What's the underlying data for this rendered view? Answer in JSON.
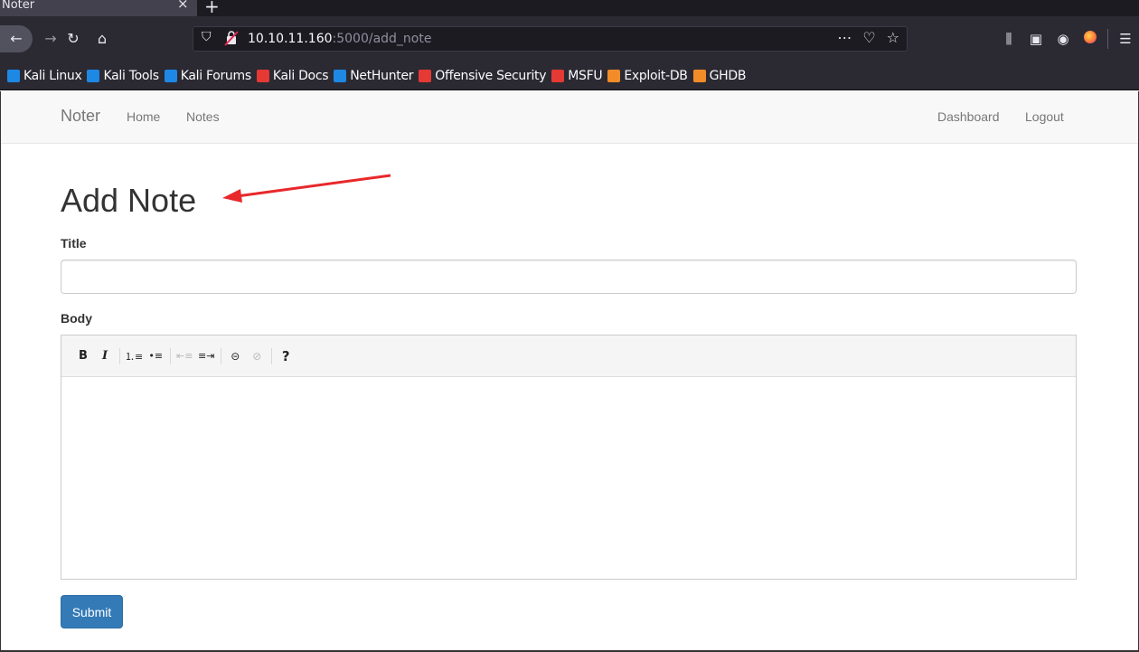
{
  "browser": {
    "tab_title": "Noter",
    "tab_close": "×",
    "new_tab": "+",
    "url_host": "10.10.11.160",
    "url_rest": ":5000/add_note",
    "bookmarks": [
      {
        "label": "Kali Linux",
        "icon": "kali-dragon-icon",
        "color": "#1e88e5"
      },
      {
        "label": "Kali Tools",
        "icon": "kali-tools-icon",
        "color": "#1e88e5"
      },
      {
        "label": "Kali Forums",
        "icon": "kali-forums-icon",
        "color": "#1e88e5"
      },
      {
        "label": "Kali Docs",
        "icon": "kali-docs-icon",
        "color": "#e53935"
      },
      {
        "label": "NetHunter",
        "icon": "nethunter-icon",
        "color": "#1e88e5"
      },
      {
        "label": "Offensive Security",
        "icon": "offsec-icon",
        "color": "#e53935"
      },
      {
        "label": "MSFU",
        "icon": "msfu-icon",
        "color": "#e53935"
      },
      {
        "label": "Exploit-DB",
        "icon": "exploit-db-icon",
        "color": "#f28c28"
      },
      {
        "label": "GHDB",
        "icon": "ghdb-icon",
        "color": "#f28c28"
      }
    ]
  },
  "app_nav": {
    "brand": "Noter",
    "left_links": [
      "Home",
      "Notes"
    ],
    "right_links": [
      "Dashboard",
      "Logout"
    ]
  },
  "form": {
    "heading": "Add Note",
    "title_label": "Title",
    "title_value": "",
    "body_label": "Body",
    "toolbar": {
      "bold": "B",
      "italic": "I",
      "help": "?"
    },
    "submit_label": "Submit"
  },
  "colors": {
    "primary_button": "#337ab7",
    "annotation_arrow": "#e8282b"
  }
}
